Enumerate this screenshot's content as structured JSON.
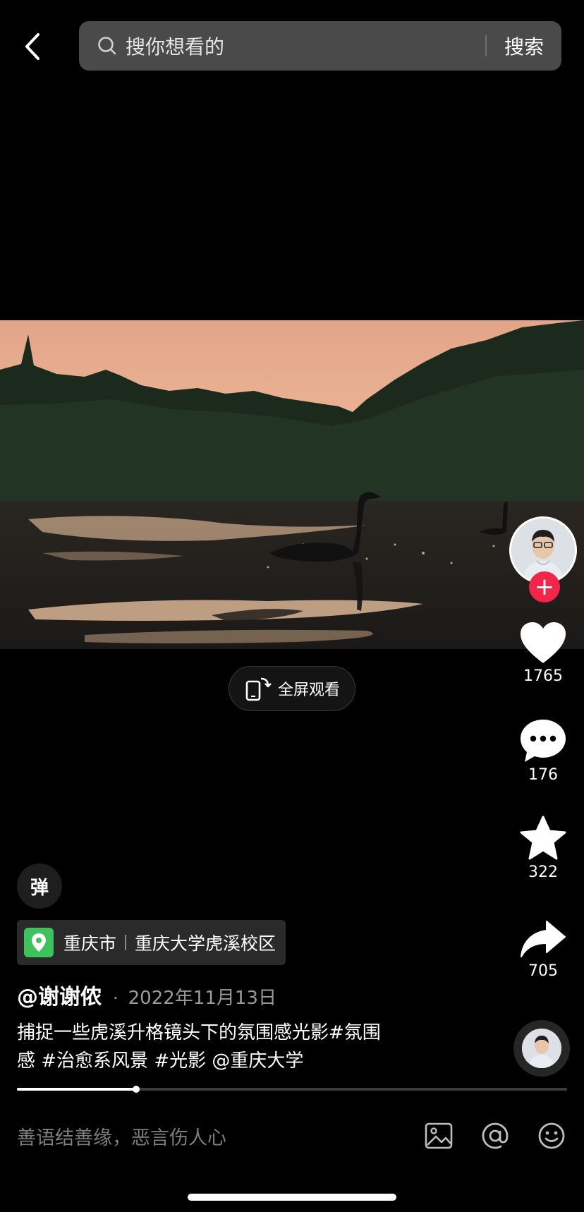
{
  "search": {
    "placeholder": "搜你想看的",
    "submit_label": "搜索"
  },
  "video": {
    "fullscreen_label": "全屏观看"
  },
  "rail": {
    "like_count": "1765",
    "comment_count": "176",
    "favorite_count": "322",
    "share_count": "705",
    "follow_symbol": "+"
  },
  "danmu_label": "弹",
  "location": {
    "city": "重庆市",
    "place": "重庆大学虎溪校区"
  },
  "post": {
    "author": "@谢谢侬",
    "separator": "·",
    "date": "2022年11月13日",
    "caption_line1": "捕捉一些虎溪升格镜头下的氛围感光影#氛围",
    "caption_line2": "感 #治愈系风景 #光影 @重庆大学"
  },
  "playback": {
    "progress_fraction": 0.217
  },
  "comment_bar": {
    "placeholder": "善语结善缘，恶言伤人心"
  },
  "colors": {
    "background": "#000000",
    "search_bg": "#4a4a4a",
    "follow_red": "#f2264b",
    "location_green": "#3fc15d",
    "muted_text": "#9a9a9a"
  },
  "icons": {
    "back": "chevron-left-icon",
    "search": "search-icon",
    "like": "heart-icon",
    "comment": "comment-bubble-icon",
    "favorite": "star-icon",
    "share": "share-arrow-icon",
    "location": "location-pin-icon",
    "image": "image-icon",
    "mention": "at-icon",
    "emoji": "emoji-icon",
    "rotate": "rotate-phone-icon"
  }
}
